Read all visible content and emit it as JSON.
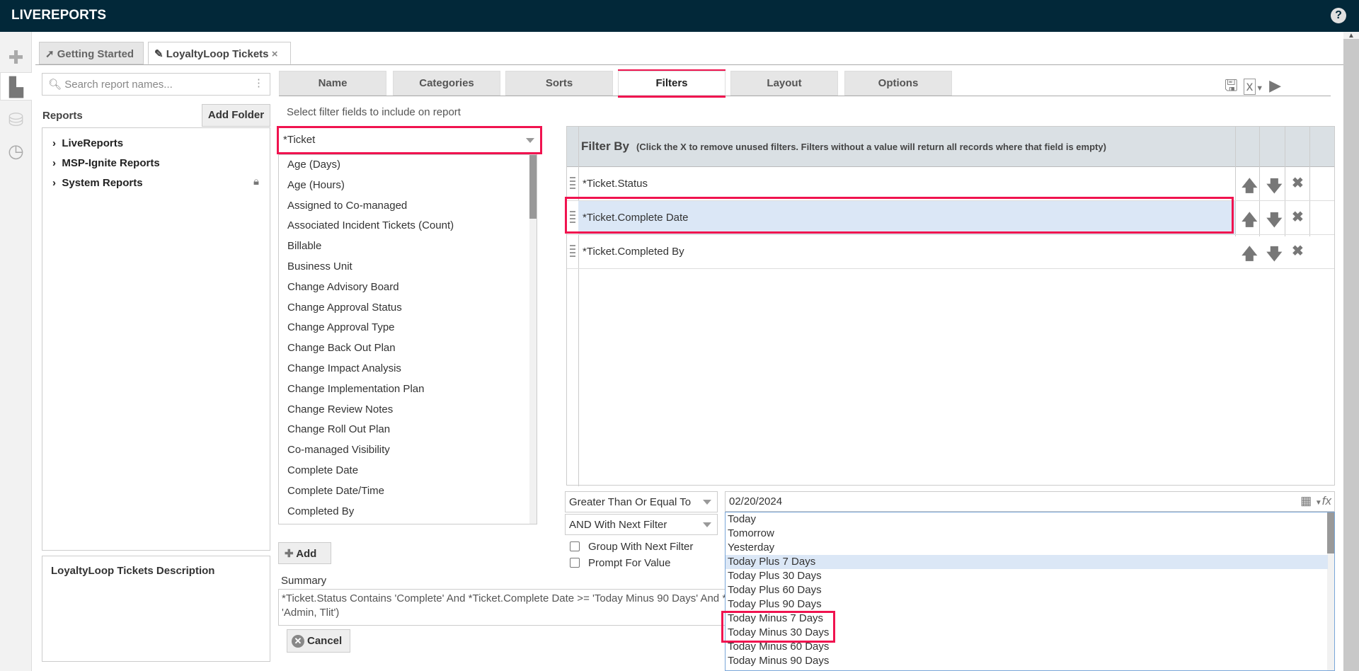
{
  "app": {
    "title": "LIVEREPORTS",
    "help_icon": "?"
  },
  "rail": [
    {
      "icon": "plus-icon"
    },
    {
      "icon": "document-icon"
    },
    {
      "icon": "database-icon"
    },
    {
      "icon": "clock-icon"
    }
  ],
  "window_tabs": [
    {
      "label": "Getting Started",
      "icon": "arrow-circle-icon"
    },
    {
      "label": "LoyaltyLoop Tickets",
      "icon": "pencil-icon",
      "close": "×"
    }
  ],
  "sidebar": {
    "search_placeholder": "Search report names...",
    "reports_label": "Reports",
    "add_folder": "Add Folder",
    "tree": [
      {
        "label": "LiveReports"
      },
      {
        "label": "MSP-Ignite Reports"
      },
      {
        "label": "System Reports",
        "locked": true
      }
    ],
    "description": "LoyaltyLoop Tickets Description"
  },
  "report_tabs": [
    {
      "label": "Name"
    },
    {
      "label": "Categories"
    },
    {
      "label": "Sorts"
    },
    {
      "label": "Filters",
      "active": true
    },
    {
      "label": "Layout"
    },
    {
      "label": "Options"
    }
  ],
  "filters": {
    "hint": "Select filter fields to include on report",
    "field_group": "*Ticket",
    "fields": [
      "Age (Days)",
      "Age (Hours)",
      "Assigned to Co-managed",
      "Associated Incident Tickets (Count)",
      "Billable",
      "Business Unit",
      "Change Advisory Board",
      "Change Approval Status",
      "Change Approval Type",
      "Change Back Out Plan",
      "Change Impact Analysis",
      "Change Implementation Plan",
      "Change Review Notes",
      "Change Roll Out Plan",
      "Co-managed Visibility",
      "Complete Date",
      "Complete Date/Time",
      "Completed By"
    ],
    "add_label": "Add",
    "table_title": "Filter By",
    "table_note": "(Click the X to remove unused filters. Filters without a value will return all records where that field is empty)",
    "rows": [
      {
        "label": "*Ticket.Status"
      },
      {
        "label": "*Ticket.Complete Date",
        "selected": true
      },
      {
        "label": "*Ticket.Completed By"
      }
    ],
    "operator": "Greater Than Or Equal To",
    "conjunction": "AND With Next Filter",
    "group_label": "Group With Next Filter",
    "prompt_label": "Prompt For Value",
    "value": "02/20/2024",
    "value_options": [
      "Today",
      "Tomorrow",
      "Yesterday",
      "Today Plus 7 Days",
      "Today Plus 30 Days",
      "Today Plus 60 Days",
      "Today Plus 90 Days",
      "Today Minus 7 Days",
      "Today Minus 30 Days",
      "Today Minus 60 Days",
      "Today Minus 90 Days"
    ],
    "value_highlighted": "Today Plus 7 Days",
    "summary_label": "Summary",
    "summary": "*Ticket.Status Contains 'Complete' And *Ticket.Complete Date >= 'Today Minus 90 Days' And *",
    "summary_line2": "'Admin, Tlit')",
    "cancel": "Cancel"
  },
  "highlight_color": "#f0134f"
}
